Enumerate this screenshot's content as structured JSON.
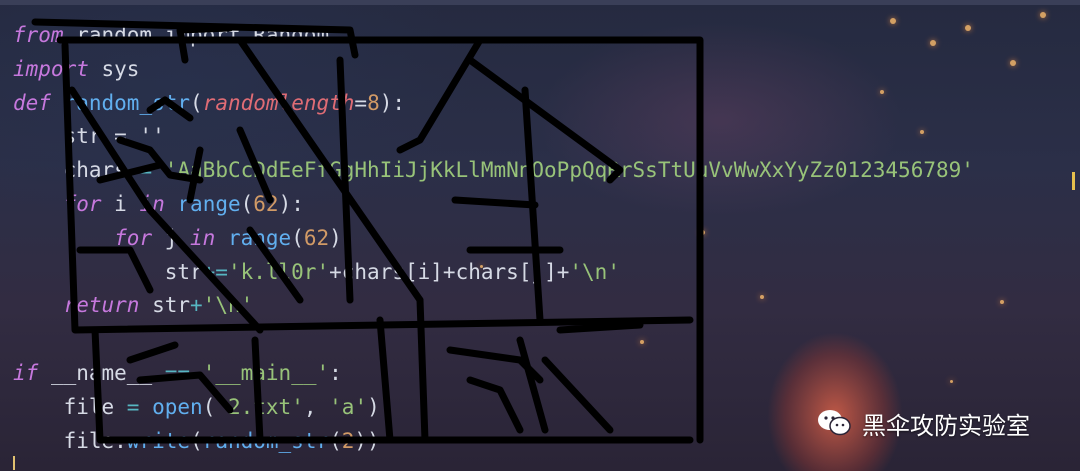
{
  "editor": {
    "lines": [
      {
        "i": 0,
        "segs": [
          [
            "from",
            "kw"
          ],
          [
            " random import Random",
            ""
          ]
        ]
      },
      {
        "i": 1,
        "segs": [
          [
            "import",
            "kw"
          ],
          [
            " sys",
            ""
          ]
        ]
      },
      {
        "i": 2,
        "segs": [
          [
            "def",
            "kw"
          ],
          [
            " ",
            ""
          ],
          [
            "random_str",
            "fn"
          ],
          [
            "(",
            ""
          ],
          [
            "randomlength",
            "prm"
          ],
          [
            "=",
            ""
          ],
          [
            "8",
            "num"
          ],
          [
            "):",
            ""
          ]
        ]
      },
      {
        "i": 3,
        "segs": [
          [
            "    str = ''",
            ""
          ]
        ]
      },
      {
        "i": 4,
        "segs": [
          [
            "    chars ",
            ""
          ],
          [
            "=",
            "op"
          ],
          [
            " ",
            ""
          ],
          [
            "'AaBbCcDdEeFfGgHhIiJjKkLlMmNnOoPpQqRrSsTtUuVvWwXxYyZz0123456789'",
            "str"
          ]
        ]
      },
      {
        "i": 5,
        "segs": [
          [
            "    ",
            ""
          ],
          [
            "for",
            "kw"
          ],
          [
            " i ",
            ""
          ],
          [
            "in",
            "kw"
          ],
          [
            " ",
            ""
          ],
          [
            "range",
            "fn"
          ],
          [
            "(",
            ""
          ],
          [
            "62",
            "num"
          ],
          [
            "):",
            ""
          ]
        ]
      },
      {
        "i": 6,
        "segs": [
          [
            "        ",
            ""
          ],
          [
            "for",
            "kw"
          ],
          [
            " j ",
            ""
          ],
          [
            "in",
            "kw"
          ],
          [
            " ",
            ""
          ],
          [
            "range",
            "fn"
          ],
          [
            "(",
            ""
          ],
          [
            "62",
            "num"
          ],
          [
            "):",
            ""
          ]
        ]
      },
      {
        "i": 7,
        "segs": [
          [
            "            str",
            ""
          ],
          [
            "+=",
            "op"
          ],
          [
            "'k.ll0r'",
            "str"
          ],
          [
            "+",
            ""
          ],
          [
            "chars[i]",
            ""
          ],
          [
            "+",
            ""
          ],
          [
            "chars[j]",
            ""
          ],
          [
            "+",
            ""
          ],
          [
            "'\\n'",
            "str"
          ]
        ]
      },
      {
        "i": 8,
        "segs": [
          [
            "    ",
            ""
          ],
          [
            "return",
            "kw"
          ],
          [
            " str",
            ""
          ],
          [
            "+",
            "op"
          ],
          [
            "'\\n'",
            "str"
          ]
        ]
      },
      {
        "i": 9,
        "segs": [
          [
            "",
            ""
          ]
        ]
      },
      {
        "i": 10,
        "segs": [
          [
            "if",
            "kw"
          ],
          [
            " __name__ ",
            ""
          ],
          [
            "==",
            "op"
          ],
          [
            " ",
            ""
          ],
          [
            "'__main__'",
            "str"
          ],
          [
            ":",
            ""
          ]
        ]
      },
      {
        "i": 11,
        "segs": [
          [
            "    file ",
            ""
          ],
          [
            "=",
            "op"
          ],
          [
            " ",
            ""
          ],
          [
            "open",
            "fn"
          ],
          [
            "(",
            ""
          ],
          [
            "'2.txt'",
            "str"
          ],
          [
            ", ",
            ""
          ],
          [
            "'a'",
            "str"
          ],
          [
            ")",
            ""
          ]
        ]
      },
      {
        "i": 12,
        "segs": [
          [
            "    file.",
            ""
          ],
          [
            "write",
            "fn"
          ],
          [
            "(",
            ""
          ],
          [
            "random_str",
            "fn"
          ],
          [
            "(",
            ""
          ],
          [
            "2",
            "num"
          ],
          [
            "))",
            ""
          ]
        ]
      }
    ]
  },
  "watermark": {
    "text": "黑伞攻防实验室",
    "icon": "wechat-icon"
  }
}
